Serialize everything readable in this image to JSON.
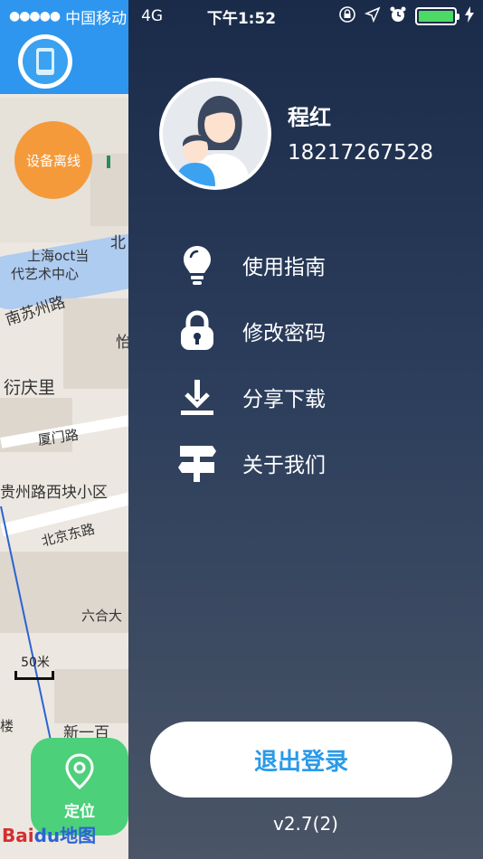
{
  "status_bar": {
    "signal_dots": "●●●●●",
    "carrier": "中国移动",
    "network": "4G",
    "time": "下午1:52",
    "battery_level": 1.0
  },
  "map": {
    "offline_badge": "设备离线",
    "locate_button": "定位",
    "scale_label": "50米",
    "labels": {
      "shanghai_oct": "上海oct当",
      "art_center": "代艺术中心",
      "nansuzhou_road": "南苏州路",
      "yanqingli": "衍庆里",
      "xiamen_road": "厦门路",
      "guizhou_road": "贵州路西块小区",
      "beijing_east_road": "北京东路",
      "liuhe": "六合大",
      "xinyibai": "新一百",
      "bei": "北",
      "yi": "怡",
      "lou": "楼"
    },
    "logo_bai": "Bai",
    "logo_du": "du地图",
    "colors": {
      "topbar": "#2e96ee",
      "offline": "#f59a3b",
      "locate": "#4cd07a"
    }
  },
  "drawer": {
    "user": {
      "name": "程红",
      "phone": "18217267528"
    },
    "menu": [
      {
        "label": "使用指南",
        "icon": "lightbulb-icon"
      },
      {
        "label": "修改密码",
        "icon": "lock-icon"
      },
      {
        "label": "分享下载",
        "icon": "download-icon"
      },
      {
        "label": "关于我们",
        "icon": "signpost-icon"
      }
    ],
    "logout_label": "退出登录",
    "version": "v2.7(2)"
  }
}
